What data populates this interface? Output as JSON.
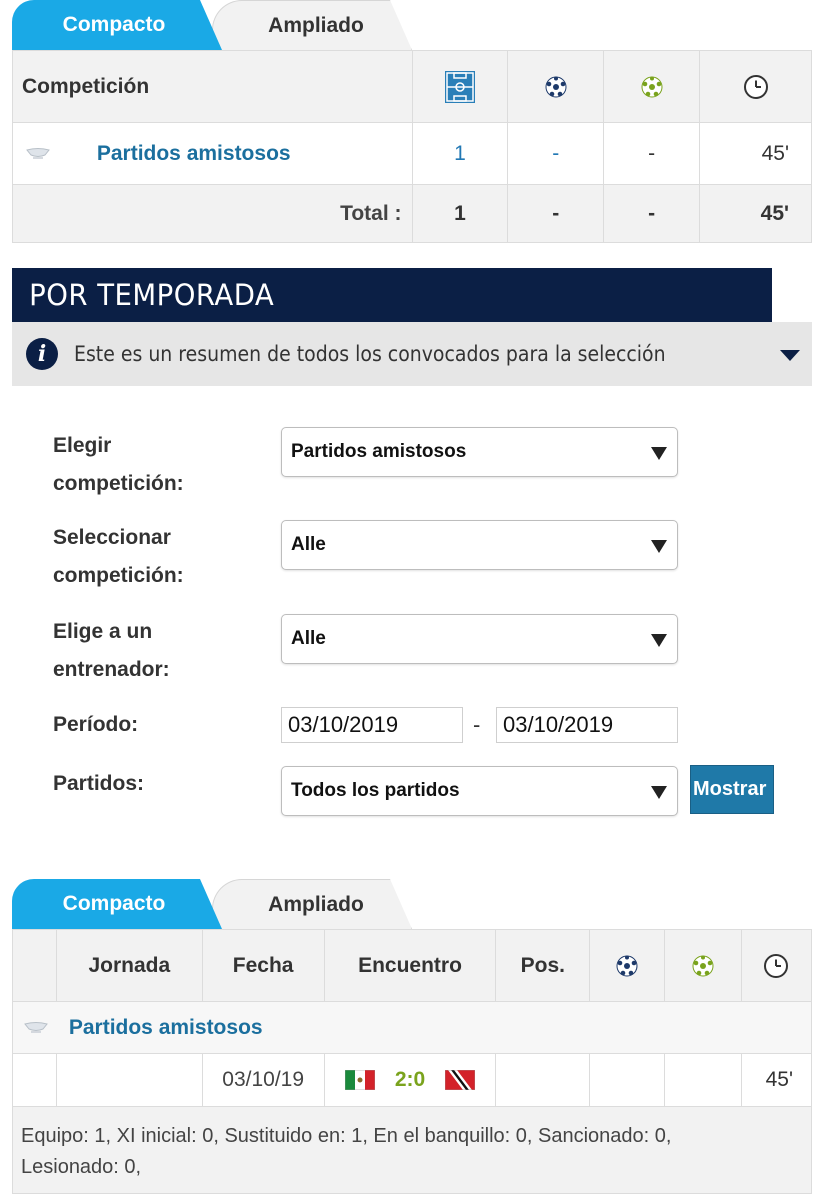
{
  "top_tabs": {
    "compact": "Compacto",
    "expanded": "Ampliado"
  },
  "summary_table": {
    "header": {
      "competition": "Competición"
    },
    "row": {
      "competition": "Partidos amistosos",
      "appearances": "1",
      "goals": "-",
      "assists": "-",
      "minutes": "45'"
    },
    "total": {
      "label": "Total :",
      "appearances": "1",
      "goals": "-",
      "assists": "-",
      "minutes": "45'"
    }
  },
  "season": {
    "title": "POR TEMPORADA",
    "info_text": "Este es un resumen de todos los convocados para la selección"
  },
  "form": {
    "competition_label_1": "Elegir",
    "competition_label_2": "competición:",
    "competition_value": "Partidos amistosos",
    "select_comp_label_1": "Seleccionar",
    "select_comp_label_2": "competición:",
    "select_comp_value": "Alle",
    "coach_label_1": "Elige a un",
    "coach_label_2": "entrenador:",
    "coach_value": "Alle",
    "period_label": "Período:",
    "date_from": "03/10/2019",
    "date_dash": "-",
    "date_to": "03/10/2019",
    "matches_label": "Partidos:",
    "matches_value": "Todos los partidos",
    "show_button": "Mostrar"
  },
  "bottom_tabs": {
    "compact": "Compacto",
    "expanded": "Ampliado"
  },
  "match_table": {
    "headers": {
      "round": "Jornada",
      "date": "Fecha",
      "match": "Encuentro",
      "pos": "Pos."
    },
    "group": "Partidos amistosos",
    "row": {
      "round": "",
      "date": "03/10/19",
      "score": "2:0",
      "pos": "",
      "goals": "",
      "assists": "",
      "minutes": "45'"
    }
  },
  "summary_text": {
    "line1": "Equipo: 1, XI inicial: 0, Sustituido en: 1, En el banquillo: 0, Sancionado: 0,",
    "line2": "Lesionado: 0,"
  },
  "colors": {
    "tab_active": "#1aa9e6",
    "banner": "#0b1f45",
    "link": "#1b6f9e",
    "score": "#7aa31d",
    "button": "#1f79a8"
  },
  "icons": [
    "field-icon",
    "ball-icon",
    "assist-ball-icon",
    "clock-icon",
    "trophy-icon",
    "info-icon",
    "flag-mexico-icon",
    "flag-trinidad-icon"
  ]
}
